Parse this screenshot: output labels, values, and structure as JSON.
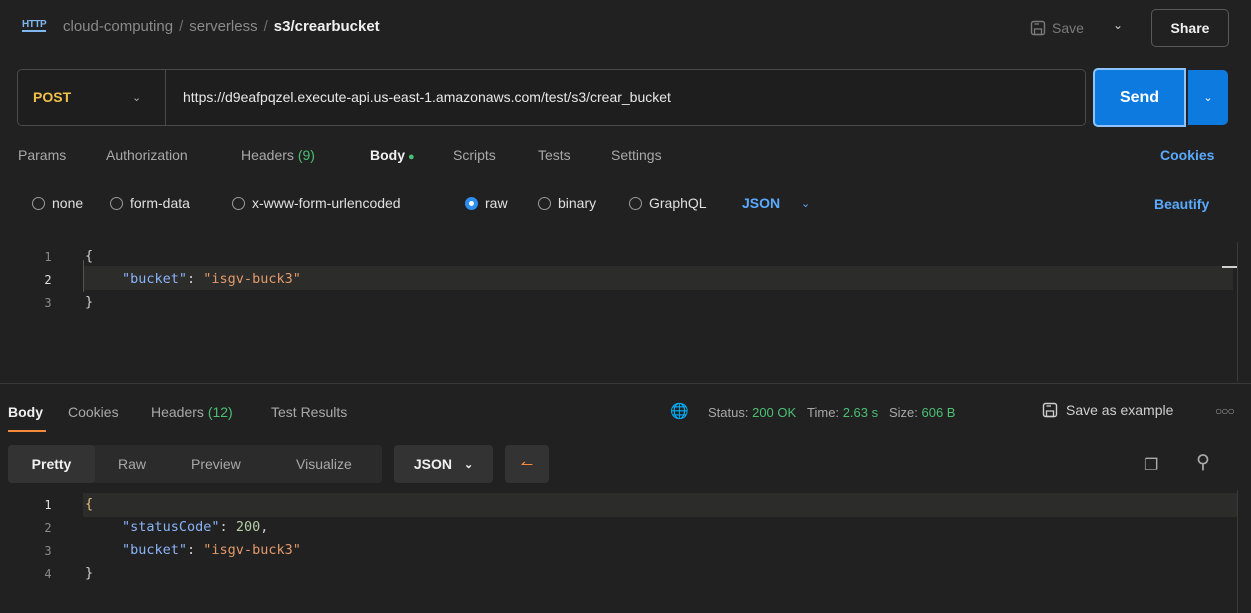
{
  "header": {
    "icon_label": "HTTP",
    "breadcrumb": [
      "cloud-computing",
      "serverless"
    ],
    "separator": "/",
    "current": "s3/crearbucket",
    "save_label": "Save",
    "share_label": "Share"
  },
  "request": {
    "method": "POST",
    "url": "https://d9eafpqzel.execute-api.us-east-1.amazonaws.com/test/s3/crear_bucket",
    "send_label": "Send"
  },
  "request_tabs": {
    "params": "Params",
    "authorization": "Authorization",
    "headers": "Headers",
    "headers_count": "(9)",
    "body": "Body",
    "scripts": "Scripts",
    "tests": "Tests",
    "settings": "Settings",
    "cookies": "Cookies"
  },
  "body_types": {
    "none": "none",
    "form_data": "form-data",
    "urlencoded": "x-www-form-urlencoded",
    "raw": "raw",
    "binary": "binary",
    "graphql": "GraphQL",
    "format": "JSON",
    "beautify": "Beautify",
    "selected": "raw"
  },
  "request_body": {
    "line_numbers": [
      "1",
      "2",
      "3"
    ],
    "open": "{",
    "key": "\"bucket\"",
    "colon": ": ",
    "value": "\"isgv-buck3\"",
    "close": "}"
  },
  "response_tabs": {
    "body": "Body",
    "cookies": "Cookies",
    "headers": "Headers",
    "headers_count": "(12)",
    "test_results": "Test Results"
  },
  "response_status": {
    "status_label": "Status:",
    "status_value": "200 OK",
    "time_label": "Time:",
    "time_value": "2.63 s",
    "size_label": "Size:",
    "size_value": "606 B",
    "save_example": "Save as example"
  },
  "response_view": {
    "pretty": "Pretty",
    "raw": "Raw",
    "preview": "Preview",
    "visualize": "Visualize",
    "format": "JSON"
  },
  "response_body": {
    "line_numbers": [
      "1",
      "2",
      "3",
      "4"
    ],
    "open": "{",
    "key1": "\"statusCode\"",
    "value1": "200",
    "key2": "\"bucket\"",
    "value2": "\"isgv-buck3\"",
    "close": "}"
  },
  "colors": {
    "accent_blue": "#0d7ae0",
    "status_green": "#4bbf73",
    "method_yellow": "#f0c04a",
    "active_tab_orange": "#f58a3a"
  }
}
